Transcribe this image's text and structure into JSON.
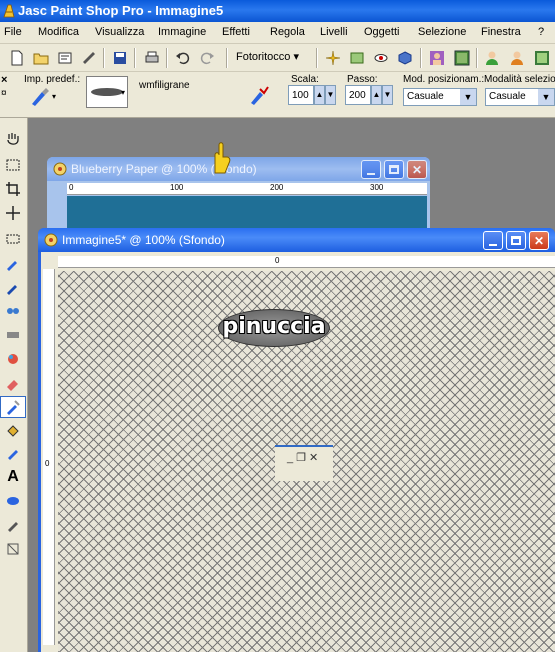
{
  "app": {
    "title": "Jasc Paint Shop Pro - Immagine5"
  },
  "menu": {
    "items": [
      "File",
      "Modifica",
      "Visualizza",
      "Immagine",
      "Effetti",
      "Regola",
      "Livelli",
      "Oggetti",
      "Selezione",
      "Finestra",
      "?"
    ]
  },
  "toolbar": {
    "fotoritocco_label": "Fotoritocco"
  },
  "options": {
    "preset_label": "Imp. predef.:",
    "watermark_name": "wmfiligrane",
    "scale_label": "Scala:",
    "scale_value": "100",
    "step_label": "Passo:",
    "step_value": "200",
    "position_mode_label": "Mod. posizionam.:",
    "position_mode_value": "Casuale",
    "selection_mode_label": "Modalità selezione",
    "selection_mode_value": "Casuale"
  },
  "windows": {
    "blueberry": {
      "title": "Blueberry Paper @ 100% (Sfondo)",
      "ruler_ticks": [
        "0",
        "100",
        "200",
        "300"
      ]
    },
    "immagine5": {
      "title": "Immagine5* @ 100% (Sfondo)",
      "ruler_h_tick": "0",
      "ruler_v_tick": "0",
      "watermark_text": "pinuccia"
    }
  },
  "colors": {
    "titlebar": "#0a5bdb",
    "chrome": "#ece9d8",
    "workspace": "#808080",
    "blueberry_canvas": "#1f6f96"
  }
}
